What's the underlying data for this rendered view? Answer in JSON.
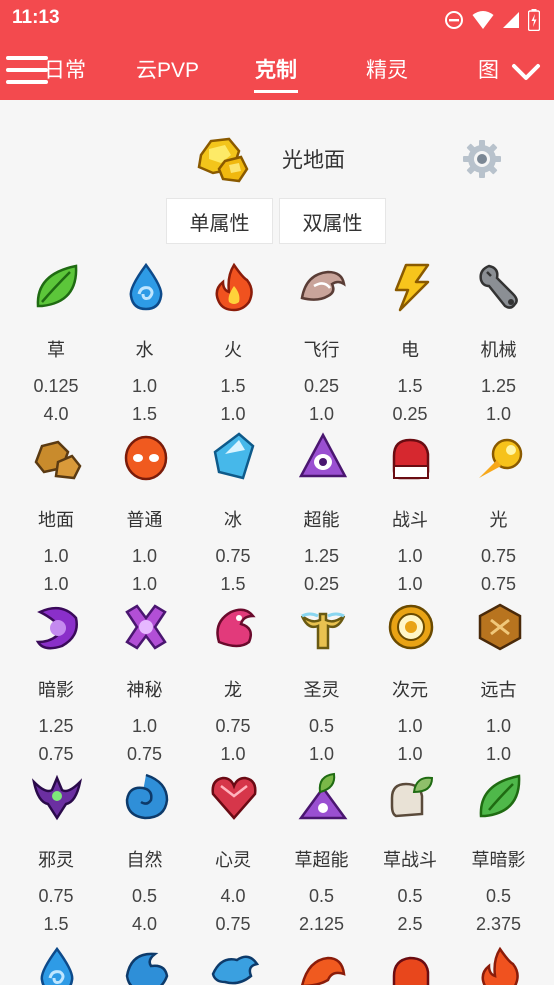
{
  "status_bar": {
    "time": "11:13",
    "icons": [
      "dnd-icon",
      "wifi-icon",
      "signal-icon",
      "battery-charging-icon"
    ]
  },
  "nav": {
    "tabs": [
      "日常",
      "云PVP",
      "克制",
      "精灵",
      "图"
    ],
    "active_tab": "克制"
  },
  "header": {
    "selected_type": "光地面",
    "settings_icon": "gear-icon"
  },
  "mode_toggle": {
    "single": "单属性",
    "dual": "双属性"
  },
  "types": [
    {
      "name": "草",
      "icon": "leaf-icon",
      "color": "#5cc63a",
      "v1": "0.125",
      "v2": "4.0"
    },
    {
      "name": "水",
      "icon": "water-drop-icon",
      "color": "#2e9be6",
      "v1": "1.0",
      "v2": "1.5"
    },
    {
      "name": "火",
      "icon": "fire-icon",
      "color": "#f0521f",
      "v1": "1.5",
      "v2": "1.0"
    },
    {
      "name": "飞行",
      "icon": "wing-icon",
      "color": "#c9a49a",
      "v1": "0.25",
      "v2": "1.0"
    },
    {
      "name": "电",
      "icon": "lightning-icon",
      "color": "#f7c51c",
      "v1": "1.5",
      "v2": "0.25"
    },
    {
      "name": "机械",
      "icon": "wrench-icon",
      "color": "#8b8f94",
      "v1": "1.25",
      "v2": "1.0"
    },
    {
      "name": "地面",
      "icon": "rock-icon",
      "color": "#c98b2c",
      "v1": "1.0",
      "v2": "1.0"
    },
    {
      "name": "普通",
      "icon": "normal-face-icon",
      "color": "#f05a1f",
      "v1": "1.0",
      "v2": "1.0"
    },
    {
      "name": "冰",
      "icon": "ice-crystal-icon",
      "color": "#46b8ea",
      "v1": "0.75",
      "v2": "1.5"
    },
    {
      "name": "超能",
      "icon": "psychic-eye-icon",
      "color": "#9a4fd1",
      "v1": "1.25",
      "v2": "0.25"
    },
    {
      "name": "战斗",
      "icon": "fighting-glove-icon",
      "color": "#d6282f",
      "v1": "1.0",
      "v2": "1.0"
    },
    {
      "name": "光",
      "icon": "light-comet-icon",
      "color": "#f6c21b",
      "v1": "0.75",
      "v2": "0.75"
    },
    {
      "name": "暗影",
      "icon": "shadow-swirl-icon",
      "color": "#8a2fc9",
      "v1": "1.25",
      "v2": "0.75"
    },
    {
      "name": "神秘",
      "icon": "mystery-x-icon",
      "color": "#b24fd6",
      "v1": "1.0",
      "v2": "0.75"
    },
    {
      "name": "龙",
      "icon": "dragon-icon",
      "color": "#e23a7b",
      "v1": "0.75",
      "v2": "1.0"
    },
    {
      "name": "圣灵",
      "icon": "holy-cross-icon",
      "color": "#e9c250",
      "v1": "0.5",
      "v2": "1.0"
    },
    {
      "name": "次元",
      "icon": "dimension-ring-icon",
      "color": "#e9a315",
      "v1": "1.0",
      "v2": "1.0"
    },
    {
      "name": "远古",
      "icon": "ancient-tablet-icon",
      "color": "#b8741f",
      "v1": "1.0",
      "v2": "1.0"
    },
    {
      "name": "邪灵",
      "icon": "evil-bat-icon",
      "color": "#6b2fa1",
      "v1": "0.75",
      "v2": "1.5"
    },
    {
      "name": "自然",
      "icon": "nature-swirl-icon",
      "color": "#2f8fd8",
      "v1": "0.5",
      "v2": "4.0"
    },
    {
      "name": "心灵",
      "icon": "heart-gem-icon",
      "color": "#d6364a",
      "v1": "4.0",
      "v2": "0.75"
    },
    {
      "name": "草超能",
      "icon": "grass-psychic-icon",
      "color": "#7ab848",
      "v1": "0.5",
      "v2": "2.125"
    },
    {
      "name": "草战斗",
      "icon": "grass-fighting-icon",
      "color": "#8fbf6a",
      "v1": "0.5",
      "v2": "2.5"
    },
    {
      "name": "草暗影",
      "icon": "grass-shadow-icon",
      "color": "#4fb84a",
      "v1": "0.5",
      "v2": "2.375"
    }
  ],
  "partial_row_icons": [
    {
      "icon": "water-drop-icon",
      "color": "#2e9be6"
    },
    {
      "icon": "water-wave-icon",
      "color": "#2e8fd8"
    },
    {
      "icon": "water-dragon-icon",
      "color": "#3aa0e0"
    },
    {
      "icon": "fire-wing-icon",
      "color": "#f05a1f"
    },
    {
      "icon": "fire-fighting-icon",
      "color": "#e8471c"
    },
    {
      "icon": "fire-shadow-icon",
      "color": "#f0521f"
    }
  ]
}
